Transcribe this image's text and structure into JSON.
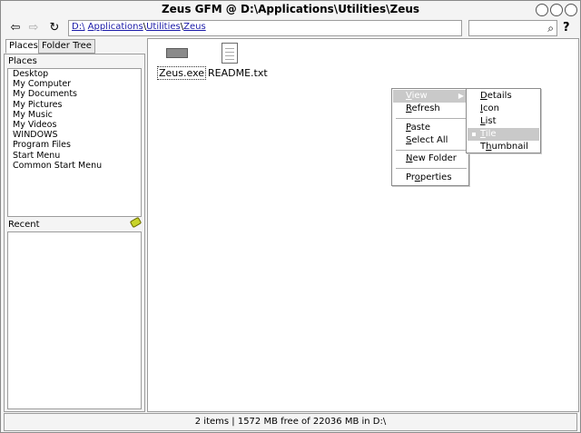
{
  "window": {
    "title": "Zeus GFM @ D:\\Applications\\Utilities\\Zeus"
  },
  "toolbar": {
    "back_icon": "arrow-left-icon",
    "forward_icon": "arrow-right-icon",
    "refresh_icon": "refresh-icon",
    "address": {
      "drive": "D:\\",
      "sep1": "\\",
      "folder1": "Applications",
      "sep2": "\\",
      "folder2": "Utilities",
      "sep3": "\\",
      "folder3": "Zeus"
    },
    "search_value": "",
    "help_label": "?"
  },
  "left": {
    "tabs": [
      "Places",
      "Folder Tree"
    ],
    "places_heading": "Places",
    "places": [
      "Desktop",
      "My Computer",
      "My Documents",
      "My Pictures",
      "My Music",
      "My Videos",
      "WINDOWS",
      "Program Files",
      "Start Menu",
      "Common Start Menu"
    ],
    "recent_heading": "Recent"
  },
  "files": [
    {
      "name": "Zeus.exe",
      "icon": "executable-icon"
    },
    {
      "name": "README.txt",
      "icon": "text-file-icon"
    }
  ],
  "context_menu": {
    "view": {
      "pre": "",
      "key": "V",
      "post": "iew"
    },
    "refresh": {
      "pre": "",
      "key": "R",
      "post": "efresh"
    },
    "paste": {
      "pre": "",
      "key": "P",
      "post": "aste"
    },
    "select_all": {
      "pre": "",
      "key": "S",
      "post": "elect All"
    },
    "new_folder": {
      "pre": "",
      "key": "N",
      "post": "ew Folder"
    },
    "properties": {
      "pre": "Pr",
      "key": "o",
      "post": "perties"
    }
  },
  "view_submenu": {
    "details": {
      "pre": "",
      "key": "D",
      "post": "etails"
    },
    "icon": {
      "pre": "",
      "key": "I",
      "post": "con"
    },
    "list": {
      "pre": "",
      "key": "L",
      "post": "ist"
    },
    "tile": {
      "pre": "",
      "key": "T",
      "post": "ile"
    },
    "thumbnail": {
      "pre": "T",
      "key": "h",
      "post": "umbnail"
    },
    "selected": "tile"
  },
  "status": "2 items | 1572 MB free of 22036 MB in D:\\"
}
